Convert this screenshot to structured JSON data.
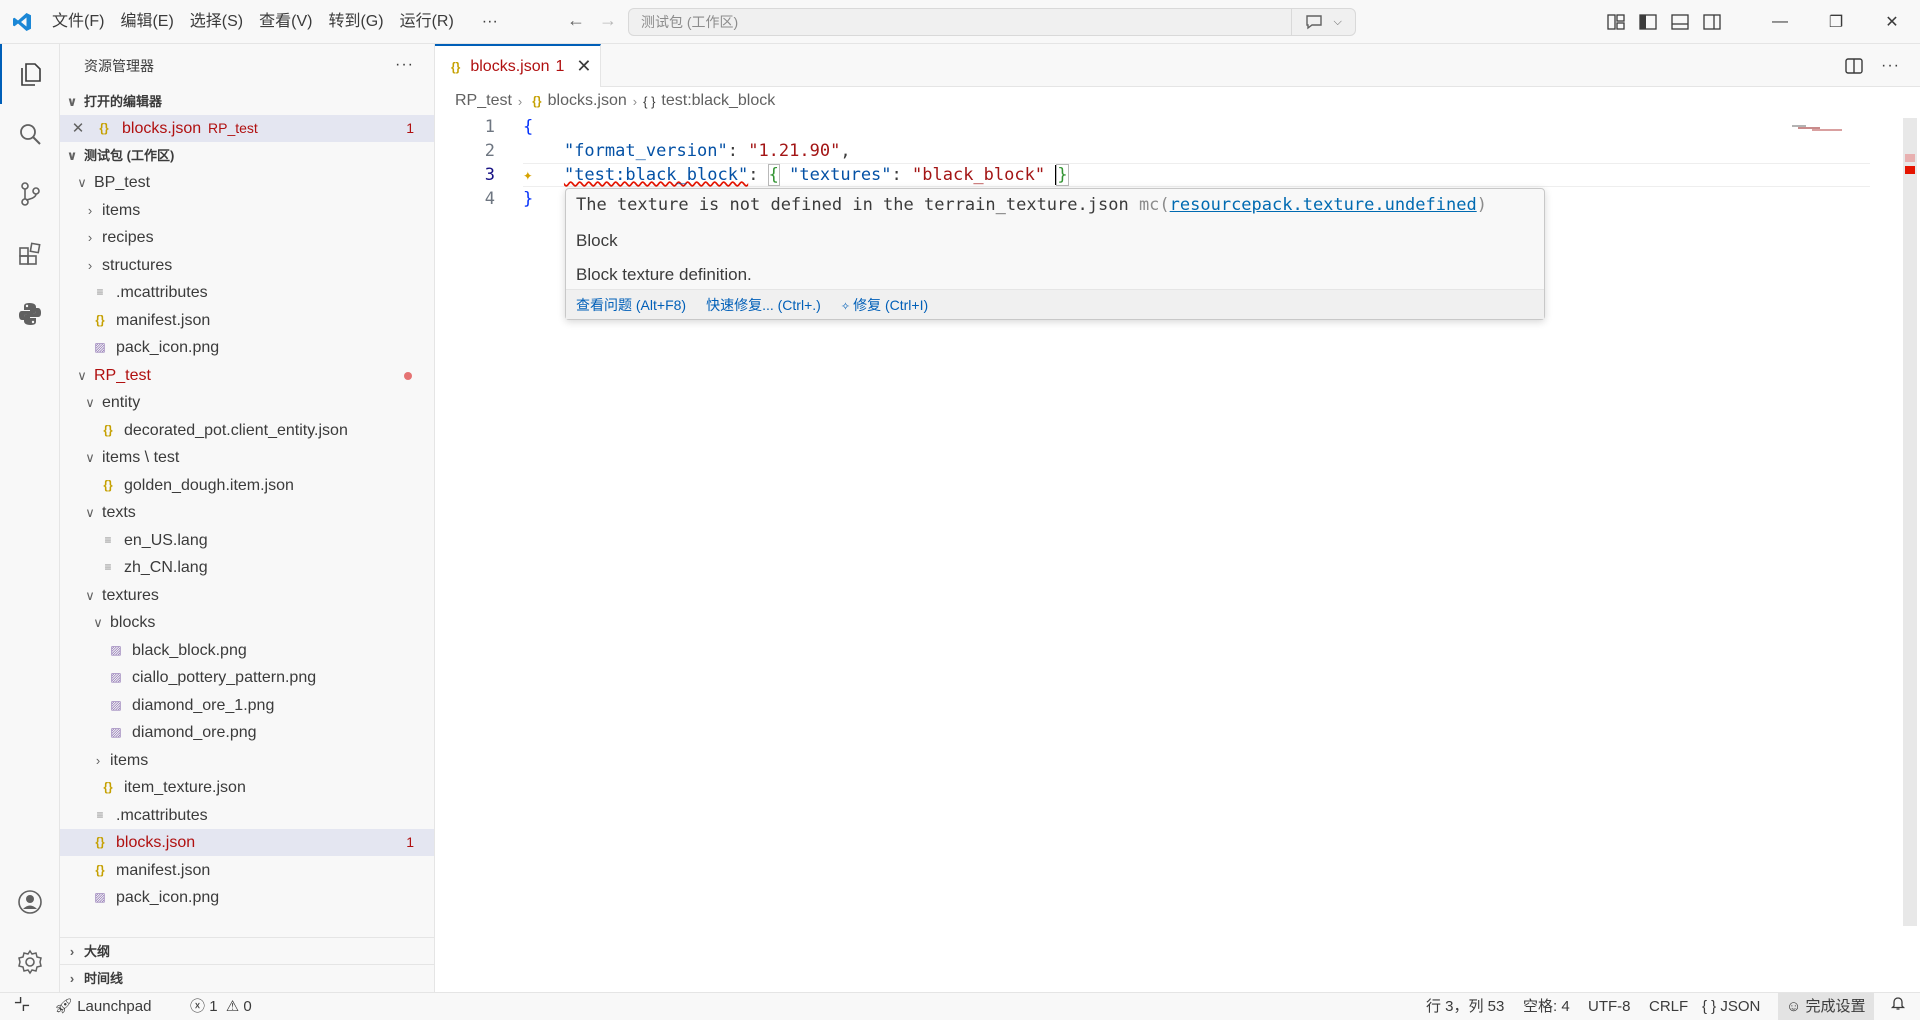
{
  "titlebar": {
    "menus": [
      "文件(F)",
      "编辑(E)",
      "选择(S)",
      "查看(V)",
      "转到(G)",
      "运行(R)",
      "···"
    ],
    "search_placeholder": "测试包 (工作区)"
  },
  "sidebar": {
    "title": "资源管理器",
    "more": "···",
    "open_editors_header": "打开的编辑器",
    "open_editor": {
      "name": "blocks.json",
      "folder": "RP_test",
      "badge": "1"
    },
    "workspace_header": "测试包 (工作区)",
    "tree": [
      {
        "label": "BP_test",
        "indent": 0,
        "twistie": "v",
        "icon": ""
      },
      {
        "label": "items",
        "indent": 1,
        "twistie": ">",
        "icon": ""
      },
      {
        "label": "recipes",
        "indent": 1,
        "twistie": ">",
        "icon": ""
      },
      {
        "label": "structures",
        "indent": 1,
        "twistie": ">",
        "icon": ""
      },
      {
        "label": ".mcattributes",
        "indent": 1,
        "twistie": "",
        "icon": "txt"
      },
      {
        "label": "manifest.json",
        "indent": 1,
        "twistie": "",
        "icon": "json"
      },
      {
        "label": "pack_icon.png",
        "indent": 1,
        "twistie": "",
        "icon": "img"
      },
      {
        "label": "RP_test",
        "indent": 0,
        "twistie": "v",
        "icon": "",
        "red": true,
        "dot": true
      },
      {
        "label": "entity",
        "indent": 1,
        "twistie": "v",
        "icon": ""
      },
      {
        "label": "decorated_pot.client_entity.json",
        "indent": 2,
        "twistie": "",
        "icon": "json"
      },
      {
        "label": "items \\ test",
        "indent": 1,
        "twistie": "v",
        "icon": ""
      },
      {
        "label": "golden_dough.item.json",
        "indent": 2,
        "twistie": "",
        "icon": "json"
      },
      {
        "label": "texts",
        "indent": 1,
        "twistie": "v",
        "icon": ""
      },
      {
        "label": "en_US.lang",
        "indent": 2,
        "twistie": "",
        "icon": "txt"
      },
      {
        "label": "zh_CN.lang",
        "indent": 2,
        "twistie": "",
        "icon": "txt"
      },
      {
        "label": "textures",
        "indent": 1,
        "twistie": "v",
        "icon": ""
      },
      {
        "label": "blocks",
        "indent": 2,
        "twistie": "v",
        "icon": ""
      },
      {
        "label": "black_block.png",
        "indent": 3,
        "twistie": "",
        "icon": "img"
      },
      {
        "label": "ciallo_pottery_pattern.png",
        "indent": 3,
        "twistie": "",
        "icon": "img"
      },
      {
        "label": "diamond_ore_1.png",
        "indent": 3,
        "twistie": "",
        "icon": "img"
      },
      {
        "label": "diamond_ore.png",
        "indent": 3,
        "twistie": "",
        "icon": "img"
      },
      {
        "label": "items",
        "indent": 2,
        "twistie": ">",
        "icon": ""
      },
      {
        "label": "item_texture.json",
        "indent": 2,
        "twistie": "",
        "icon": "json"
      },
      {
        "label": ".mcattributes",
        "indent": 1,
        "twistie": "",
        "icon": "txt"
      },
      {
        "label": "blocks.json",
        "indent": 1,
        "twistie": "",
        "icon": "json",
        "red": true,
        "selected": true,
        "badge": "1"
      },
      {
        "label": "manifest.json",
        "indent": 1,
        "twistie": "",
        "icon": "json"
      },
      {
        "label": "pack_icon.png",
        "indent": 1,
        "twistie": "",
        "icon": "img"
      }
    ],
    "outline_header": "大纲",
    "timeline_header": "时间线"
  },
  "editor": {
    "tab": {
      "label": "blocks.json",
      "badge": "1"
    },
    "breadcrumb": [
      "RP_test",
      "blocks.json",
      "test:black_block"
    ],
    "line_numbers": [
      "1",
      "2",
      "3",
      "4"
    ],
    "code": {
      "l1": "{",
      "l2_key": "\"format_version\"",
      "l2_val": "\"1.21.90\"",
      "l3_key": "\"test:black_block\"",
      "l3_inner_key": "\"textures\"",
      "l3_inner_val": "\"black_block\"",
      "l4": "}"
    },
    "hover": {
      "message": "The texture is not defined in the terrain_texture.json",
      "source": "mc(",
      "code": "resourcepack.texture.undefined",
      "source_end": ")",
      "title": "Block",
      "description": "Block texture definition.",
      "actions": [
        "查看问题 (Alt+F8)",
        "快速修复... (Ctrl+.)",
        "修复 (Ctrl+I)"
      ]
    }
  },
  "statusbar": {
    "remote": "",
    "launchpad": "Launchpad",
    "errors": "1",
    "warnings": "0",
    "position": "行 3，列 53",
    "spaces": "空格: 4",
    "encoding": "UTF-8",
    "eol": "CRLF",
    "language": "JSON",
    "setup": "完成设置"
  },
  "colors": {
    "accent": "#005fb8",
    "error": "#b01010",
    "json_key": "#0451a5",
    "json_string": "#a31515"
  }
}
